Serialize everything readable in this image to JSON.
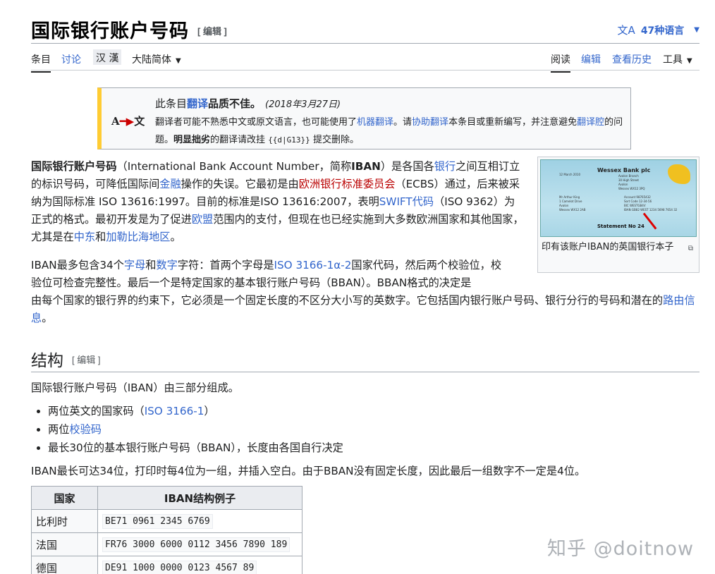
{
  "header": {
    "title": "国际银行账户号码",
    "edit_label": "[ 编辑 ]",
    "lang_label": "47种语言",
    "lang_icon": "translate-icon"
  },
  "tabs": {
    "article": "条目",
    "talk": "讨论",
    "variant_han": "汉 漢",
    "variant": "大陆简体",
    "read": "阅读",
    "edit": "编辑",
    "history": "查看历史",
    "tools": "工具"
  },
  "notice": {
    "icon_left": "A",
    "icon_right": "文",
    "title_pre": "此条目",
    "title_link": "翻译",
    "title_post": "品质不佳。",
    "date": "(2018年3月27日)",
    "line1_a": "翻译者可能不熟悉中文或原文语言，也可能使用了",
    "line1_link1": "机器翻译",
    "line1_b": "。请",
    "line1_link2": "协助翻译",
    "line1_c": "本条目或重新编写，并注意避免",
    "line1_link3": "翻译腔",
    "line2_a": "的问题。",
    "line2_bold": "明显拙劣",
    "line2_b": "的翻译请改挂",
    "line2_code": "{{d|G13}}",
    "line2_c": "提交删除。"
  },
  "figure": {
    "cheque_bank": "Wessex Bank plc",
    "cheque_statement": "Statement No 24",
    "caption": "印有该账户IBAN的英国银行本子"
  },
  "intro": {
    "b1": "国际银行账户号码",
    "t1": "（International Bank Account Number，简称",
    "b2": "IBAN",
    "t2": "）是各国各",
    "l1": "银行",
    "t3": "之间互相订立的标识号码，可降低国际间",
    "l2": "金融",
    "t4": "操作的失误。它最初是由",
    "r1": "欧洲银行标准委员会",
    "t5": "（ECBS）通过，后来被采纳为国际标准 ISO 13616:1997。目前的标准是ISO 13616:2007，表明",
    "l3": "SWIFT代码",
    "t6": "（ISO 9362）为正式的格式。最初开发是为了促进",
    "l4": "欧盟",
    "t7": "范围内的支付，但现在也已经实施到大多数欧洲国家和其他国家，尤其是在",
    "l5": "中东",
    "t8": "和",
    "l6": "加勒比海地区",
    "t9": "。"
  },
  "para2": {
    "t1": "IBAN最多包含34个",
    "l1": "字母",
    "t2": "和",
    "l2": "数字",
    "t3": "字符：首两个字母是",
    "l3": "ISO 3166-1α-2",
    "t4": "国家代码，然后两个校验位，",
    "t5": "校验位可检查完整性。最后一个是特定国家的基本银行账户号码（BBAN）。BBAN格式的决定是",
    "t6": "由每个国家的银行界的约束下，它必须是一个固定长度的不区分大小写的英数字。它包括国内银行账户号码、银行分行的号码和潜在的",
    "l4": "路由信息",
    "t7": "。"
  },
  "section": {
    "heading": "结构",
    "edit_label": "[ 编辑 ]",
    "intro": "国际银行账户号码（IBAN）由三部分组成。",
    "bullets": [
      {
        "pre": "两位英文的国家码（",
        "link": "ISO 3166-1",
        "post": "）"
      },
      {
        "pre": "两位",
        "link": "校验码",
        "post": ""
      },
      {
        "pre": "最长30位的基本银行账户号码（BBAN），长度由各国自行决定",
        "link": "",
        "post": ""
      }
    ],
    "after": "IBAN最长可达34位，打印时每4位为一组，并插入空白。由于BBAN没有固定长度，因此最后一组数字不一定是4位。"
  },
  "table": {
    "headers": [
      "国家",
      "IBAN结构例子"
    ],
    "rows": [
      [
        "比利时",
        "BE71 0961 2345 6769"
      ],
      [
        "法国",
        "FR76 3000 6000 0112 3456 7890 189"
      ],
      [
        "德国",
        "DE91 1000 0000 0123 4567 89"
      ]
    ]
  },
  "watermark": "知乎 @doitnow"
}
